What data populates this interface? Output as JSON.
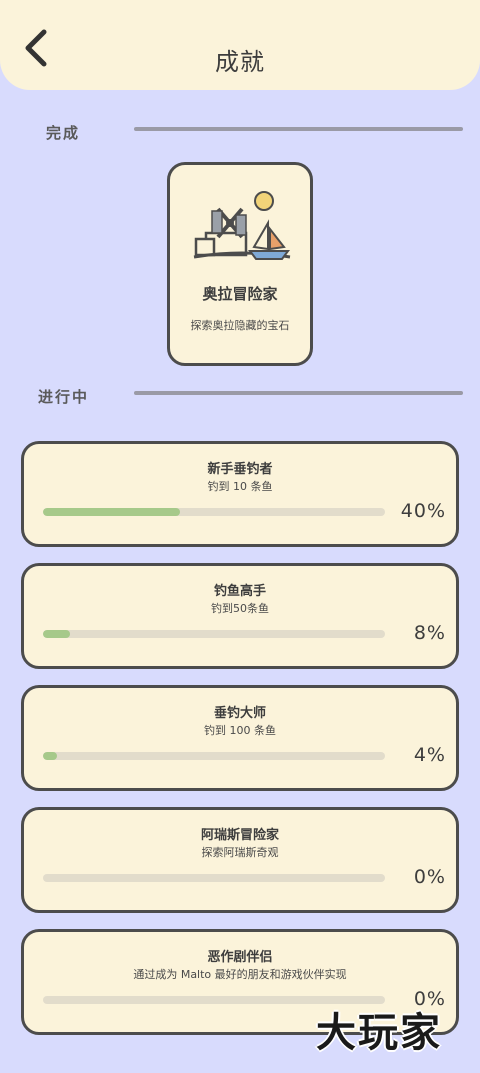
{
  "header": {
    "title": "成就",
    "back_icon": "chevron-left-icon"
  },
  "sections": {
    "completed": "完成",
    "in_progress": "进行中"
  },
  "completed": [
    {
      "title": "奥拉冒险家",
      "desc": "探索奥拉隐藏的宝石",
      "icon": "windmill-sailboat-icon"
    }
  ],
  "in_progress": [
    {
      "title": "新手垂钓者",
      "desc": "钓到 10 条鱼",
      "percent": "40%",
      "progress": 0.4
    },
    {
      "title": "钓鱼高手",
      "desc": "钓到50条鱼",
      "percent": "8%",
      "progress": 0.08
    },
    {
      "title": "垂钓大师",
      "desc": "钓到 100 条鱼",
      "percent": "4%",
      "progress": 0.04
    },
    {
      "title": "阿瑞斯冒险家",
      "desc": "探索阿瑞斯奇观",
      "percent": "0%",
      "progress": 0
    },
    {
      "title": "恶作剧伴侣",
      "desc": "通过成为 Malto 最好的朋友和游戏伙伴实现",
      "percent": "0%",
      "progress": 0
    }
  ],
  "watermark": "大玩家",
  "colors": {
    "background": "#d8dbfd",
    "card": "#fbf3da",
    "border": "#4c4c4c",
    "progress_fill": "#a6c98a",
    "progress_track": "#e2dccb"
  }
}
